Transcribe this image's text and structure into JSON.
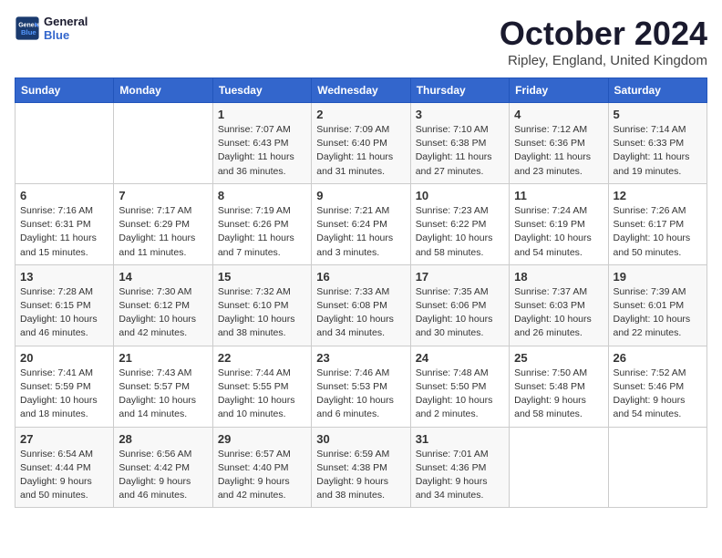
{
  "header": {
    "logo_line1": "General",
    "logo_line2": "Blue",
    "month": "October 2024",
    "location": "Ripley, England, United Kingdom"
  },
  "days_of_week": [
    "Sunday",
    "Monday",
    "Tuesday",
    "Wednesday",
    "Thursday",
    "Friday",
    "Saturday"
  ],
  "weeks": [
    [
      {
        "day": "",
        "info": ""
      },
      {
        "day": "",
        "info": ""
      },
      {
        "day": "1",
        "info": "Sunrise: 7:07 AM\nSunset: 6:43 PM\nDaylight: 11 hours and 36 minutes."
      },
      {
        "day": "2",
        "info": "Sunrise: 7:09 AM\nSunset: 6:40 PM\nDaylight: 11 hours and 31 minutes."
      },
      {
        "day": "3",
        "info": "Sunrise: 7:10 AM\nSunset: 6:38 PM\nDaylight: 11 hours and 27 minutes."
      },
      {
        "day": "4",
        "info": "Sunrise: 7:12 AM\nSunset: 6:36 PM\nDaylight: 11 hours and 23 minutes."
      },
      {
        "day": "5",
        "info": "Sunrise: 7:14 AM\nSunset: 6:33 PM\nDaylight: 11 hours and 19 minutes."
      }
    ],
    [
      {
        "day": "6",
        "info": "Sunrise: 7:16 AM\nSunset: 6:31 PM\nDaylight: 11 hours and 15 minutes."
      },
      {
        "day": "7",
        "info": "Sunrise: 7:17 AM\nSunset: 6:29 PM\nDaylight: 11 hours and 11 minutes."
      },
      {
        "day": "8",
        "info": "Sunrise: 7:19 AM\nSunset: 6:26 PM\nDaylight: 11 hours and 7 minutes."
      },
      {
        "day": "9",
        "info": "Sunrise: 7:21 AM\nSunset: 6:24 PM\nDaylight: 11 hours and 3 minutes."
      },
      {
        "day": "10",
        "info": "Sunrise: 7:23 AM\nSunset: 6:22 PM\nDaylight: 10 hours and 58 minutes."
      },
      {
        "day": "11",
        "info": "Sunrise: 7:24 AM\nSunset: 6:19 PM\nDaylight: 10 hours and 54 minutes."
      },
      {
        "day": "12",
        "info": "Sunrise: 7:26 AM\nSunset: 6:17 PM\nDaylight: 10 hours and 50 minutes."
      }
    ],
    [
      {
        "day": "13",
        "info": "Sunrise: 7:28 AM\nSunset: 6:15 PM\nDaylight: 10 hours and 46 minutes."
      },
      {
        "day": "14",
        "info": "Sunrise: 7:30 AM\nSunset: 6:12 PM\nDaylight: 10 hours and 42 minutes."
      },
      {
        "day": "15",
        "info": "Sunrise: 7:32 AM\nSunset: 6:10 PM\nDaylight: 10 hours and 38 minutes."
      },
      {
        "day": "16",
        "info": "Sunrise: 7:33 AM\nSunset: 6:08 PM\nDaylight: 10 hours and 34 minutes."
      },
      {
        "day": "17",
        "info": "Sunrise: 7:35 AM\nSunset: 6:06 PM\nDaylight: 10 hours and 30 minutes."
      },
      {
        "day": "18",
        "info": "Sunrise: 7:37 AM\nSunset: 6:03 PM\nDaylight: 10 hours and 26 minutes."
      },
      {
        "day": "19",
        "info": "Sunrise: 7:39 AM\nSunset: 6:01 PM\nDaylight: 10 hours and 22 minutes."
      }
    ],
    [
      {
        "day": "20",
        "info": "Sunrise: 7:41 AM\nSunset: 5:59 PM\nDaylight: 10 hours and 18 minutes."
      },
      {
        "day": "21",
        "info": "Sunrise: 7:43 AM\nSunset: 5:57 PM\nDaylight: 10 hours and 14 minutes."
      },
      {
        "day": "22",
        "info": "Sunrise: 7:44 AM\nSunset: 5:55 PM\nDaylight: 10 hours and 10 minutes."
      },
      {
        "day": "23",
        "info": "Sunrise: 7:46 AM\nSunset: 5:53 PM\nDaylight: 10 hours and 6 minutes."
      },
      {
        "day": "24",
        "info": "Sunrise: 7:48 AM\nSunset: 5:50 PM\nDaylight: 10 hours and 2 minutes."
      },
      {
        "day": "25",
        "info": "Sunrise: 7:50 AM\nSunset: 5:48 PM\nDaylight: 9 hours and 58 minutes."
      },
      {
        "day": "26",
        "info": "Sunrise: 7:52 AM\nSunset: 5:46 PM\nDaylight: 9 hours and 54 minutes."
      }
    ],
    [
      {
        "day": "27",
        "info": "Sunrise: 6:54 AM\nSunset: 4:44 PM\nDaylight: 9 hours and 50 minutes."
      },
      {
        "day": "28",
        "info": "Sunrise: 6:56 AM\nSunset: 4:42 PM\nDaylight: 9 hours and 46 minutes."
      },
      {
        "day": "29",
        "info": "Sunrise: 6:57 AM\nSunset: 4:40 PM\nDaylight: 9 hours and 42 minutes."
      },
      {
        "day": "30",
        "info": "Sunrise: 6:59 AM\nSunset: 4:38 PM\nDaylight: 9 hours and 38 minutes."
      },
      {
        "day": "31",
        "info": "Sunrise: 7:01 AM\nSunset: 4:36 PM\nDaylight: 9 hours and 34 minutes."
      },
      {
        "day": "",
        "info": ""
      },
      {
        "day": "",
        "info": ""
      }
    ]
  ]
}
